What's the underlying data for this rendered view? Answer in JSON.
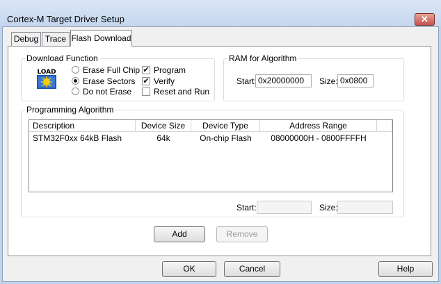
{
  "window": {
    "title": "Cortex-M Target Driver Setup",
    "close_glyph": "✕"
  },
  "tabs": [
    {
      "label": "Debug",
      "active": false
    },
    {
      "label": "Trace",
      "active": false
    },
    {
      "label": "Flash Download",
      "active": true
    }
  ],
  "download_function": {
    "legend": "Download Function",
    "icon_label": "LOAD",
    "erase_options": [
      {
        "label": "Erase Full Chip",
        "selected": false
      },
      {
        "label": "Erase Sectors",
        "selected": true
      },
      {
        "label": "Do not Erase",
        "selected": false
      }
    ],
    "checks": [
      {
        "label": "Program",
        "checked": true
      },
      {
        "label": "Verify",
        "checked": true
      },
      {
        "label": "Reset and Run",
        "checked": false
      }
    ]
  },
  "ram_for_algorithm": {
    "legend": "RAM for Algorithm",
    "start_label": "Start:",
    "start_value": "0x20000000",
    "size_label": "Size:",
    "size_value": "0x0800"
  },
  "programming_algorithm": {
    "legend": "Programming Algorithm",
    "columns": [
      "Description",
      "Device Size",
      "Device Type",
      "Address Range"
    ],
    "rows": [
      {
        "description": "STM32F0xx 64kB Flash",
        "device_size": "64k",
        "device_type": "On-chip Flash",
        "address_range": "08000000H - 0800FFFFH"
      }
    ],
    "start_label": "Start:",
    "start_value": "",
    "size_label": "Size:",
    "size_value": ""
  },
  "buttons": {
    "add": "Add",
    "remove": "Remove",
    "ok": "OK",
    "cancel": "Cancel",
    "help": "Help"
  },
  "colors": {
    "title_bar": "#c4d6ee",
    "close_button": "#c75050",
    "icon_blue": "#1a56b8",
    "icon_yellow": "#f4d000"
  }
}
